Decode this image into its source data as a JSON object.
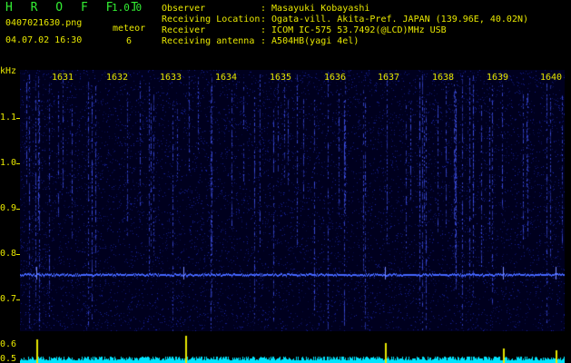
{
  "header": {
    "app_title": "H R O F F T",
    "version": "1.0.0",
    "filename": "0407021630.png",
    "datetime": "04.07.02 16:30",
    "meteor_label": "meteor",
    "meteor_count": "6"
  },
  "info": [
    {
      "key": "Observer",
      "value": ": Masayuki Kobayashi"
    },
    {
      "key": "Receiving Location",
      "value": ": Ogata-vill. Akita-Pref. JAPAN (139.96E, 40.02N)"
    },
    {
      "key": "Receiver",
      "value": ": ICOM IC-575 53.7492(@LCD)MHz USB"
    },
    {
      "key": "Receiving antenna",
      "value": ": A504HB(yagi 4el)"
    }
  ],
  "spectrogram": {
    "y_unit": "kHz",
    "y_ticks": [
      "1.1",
      "1.0",
      "0.9",
      "0.8",
      "0.7"
    ],
    "lower_y_ticks": [
      "0.6",
      "0.5"
    ],
    "time_ticks": [
      "1631",
      "1632",
      "1633",
      "1634",
      "1635",
      "1636",
      "1637",
      "1638",
      "1639",
      "1640"
    ],
    "carrier_khz": 0.752,
    "colors": {
      "background": "#00001e",
      "signal": "#3344ff",
      "carrier": "#4466ff",
      "baseline": "#00e5ff",
      "label": "#e8e800",
      "title": "#33ee33"
    }
  }
}
